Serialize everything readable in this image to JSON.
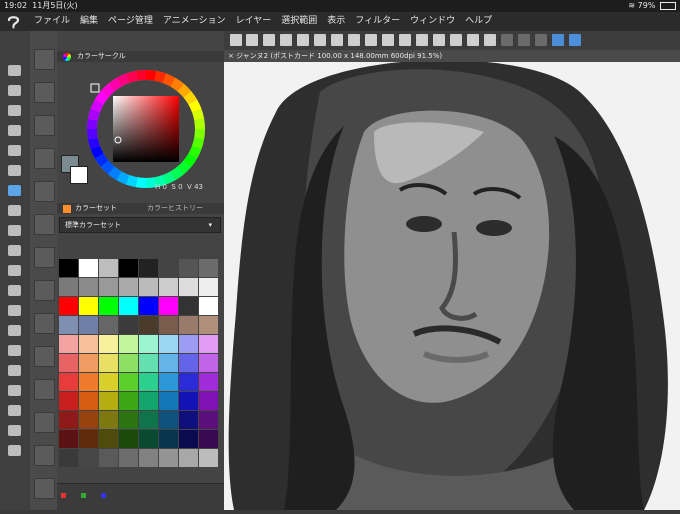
{
  "status": {
    "time": "19:02",
    "date": "11月5日(火)",
    "wifi": "wifi-icon",
    "battery": "79%"
  },
  "menu": {
    "items": [
      "ファイル",
      "編集",
      "ページ管理",
      "アニメーション",
      "レイヤー",
      "選択範囲",
      "表示",
      "フィルター",
      "ウィンドウ",
      "ヘルプ"
    ]
  },
  "tab": {
    "title": "ジャンヌ2 (ポストカード 100.00 x 148.00mm 600dpi 91.5%)"
  },
  "panels": {
    "color_circle": {
      "title": "カラーサークル",
      "readout_labels": [
        "H",
        "S",
        "V"
      ],
      "readout_values": [
        "0",
        "0",
        "43"
      ]
    },
    "color_set_tabs": [
      "カラーセット",
      "カラーヒストリー"
    ],
    "color_set_name": "標準カラーセット"
  },
  "colors": {
    "accent": "#4c8ed9",
    "palette": [
      "#000000",
      "#ffffff",
      "#bdbdbd",
      "#000000",
      "#222222",
      "#444444",
      "#555555",
      "#6b6b6b",
      "#7a7a7a",
      "#8a8a8a",
      "#999999",
      "#aaaaaa",
      "#bbbbbb",
      "#cccccc",
      "#dddddd",
      "#eeeeee",
      "#ff0000",
      "#ffff00",
      "#00ff00",
      "#00ffff",
      "#0000ff",
      "#ff00ff",
      "#333333",
      "#ffffff",
      "#7f8fb0",
      "#6f7fa8",
      "#666666",
      "#3b3b3b",
      "#4b3b2b",
      "#7b5b4b",
      "#9a7a6a",
      "#b0907a",
      "#f4a3a3",
      "#f7c09b",
      "#f7f19b",
      "#c2f59c",
      "#9cf5d0",
      "#9cd6f5",
      "#9c9cf5",
      "#e09cf5",
      "#e86464",
      "#f09a64",
      "#e8e064",
      "#8de064",
      "#64e0b0",
      "#64b4e8",
      "#6464e8",
      "#c064e8",
      "#e83b3b",
      "#f07a2b",
      "#d8cf2b",
      "#5bd02b",
      "#2bd08e",
      "#2b96d8",
      "#2b2bd8",
      "#a02bd8",
      "#c81f1f",
      "#d65c12",
      "#b5ad12",
      "#3da612",
      "#12a66c",
      "#1278b5",
      "#1212b5",
      "#8012b5",
      "#8e1a1a",
      "#97420f",
      "#7d780f",
      "#2b740f",
      "#0f744c",
      "#0f537d",
      "#0f0f7d",
      "#5a0f7d",
      "#5a1212",
      "#5f2a0a",
      "#4f4b0a",
      "#1b4a0a",
      "#0a4a30",
      "#0a354f",
      "#0a0a4f",
      "#390a4f",
      "#3a3a3a",
      "#474747",
      "#5a5a5a",
      "#6d6d6d",
      "#818181",
      "#949494",
      "#a8a8a8",
      "#bcbcbc"
    ]
  }
}
